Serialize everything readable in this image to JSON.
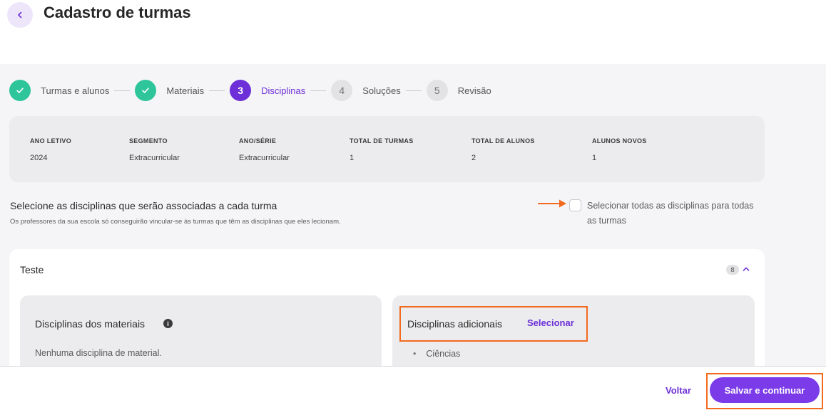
{
  "header": {
    "title": "Cadastro de turmas"
  },
  "stepper": {
    "steps": [
      {
        "number": "",
        "label": "Turmas e alunos",
        "state": "done"
      },
      {
        "number": "",
        "label": "Materiais",
        "state": "done"
      },
      {
        "number": "3",
        "label": "Disciplinas",
        "state": "active"
      },
      {
        "number": "4",
        "label": "Soluções",
        "state": "pending"
      },
      {
        "number": "5",
        "label": "Revisão",
        "state": "pending"
      }
    ]
  },
  "summary": {
    "columns": [
      {
        "label": "ANO LETIVO",
        "value": "2024"
      },
      {
        "label": "SEGMENTO",
        "value": "Extracurricular"
      },
      {
        "label": "ANO/SÉRIE",
        "value": "Extracurricular"
      },
      {
        "label": "TOTAL DE TURMAS",
        "value": "1"
      },
      {
        "label": "TOTAL DE ALUNOS",
        "value": "2"
      },
      {
        "label": "ALUNOS NOVOS",
        "value": "1"
      }
    ]
  },
  "selection": {
    "title": "Selecione as disciplinas que serão associadas a cada turma",
    "subtitle": "Os professores da sua escola só conseguirão vincular-se às turmas que têm as disciplinas que eles lecionam.",
    "select_all_label": "Selecionar todas as disciplinas para todas as turmas",
    "select_all_checked": false
  },
  "class_panel": {
    "name": "Teste",
    "count": "8",
    "materials": {
      "title": "Disciplinas dos materiais",
      "empty_text": "Nenhuma disciplina de material."
    },
    "additional": {
      "title": "Disciplinas adicionais",
      "select_label": "Selecionar",
      "items": [
        "Ciências"
      ]
    }
  },
  "footer": {
    "back_label": "Voltar",
    "save_label": "Salvar e continuar"
  },
  "colors": {
    "accent": "#6d2fd8",
    "success": "#2fc59b",
    "highlight": "#f26a1e"
  }
}
